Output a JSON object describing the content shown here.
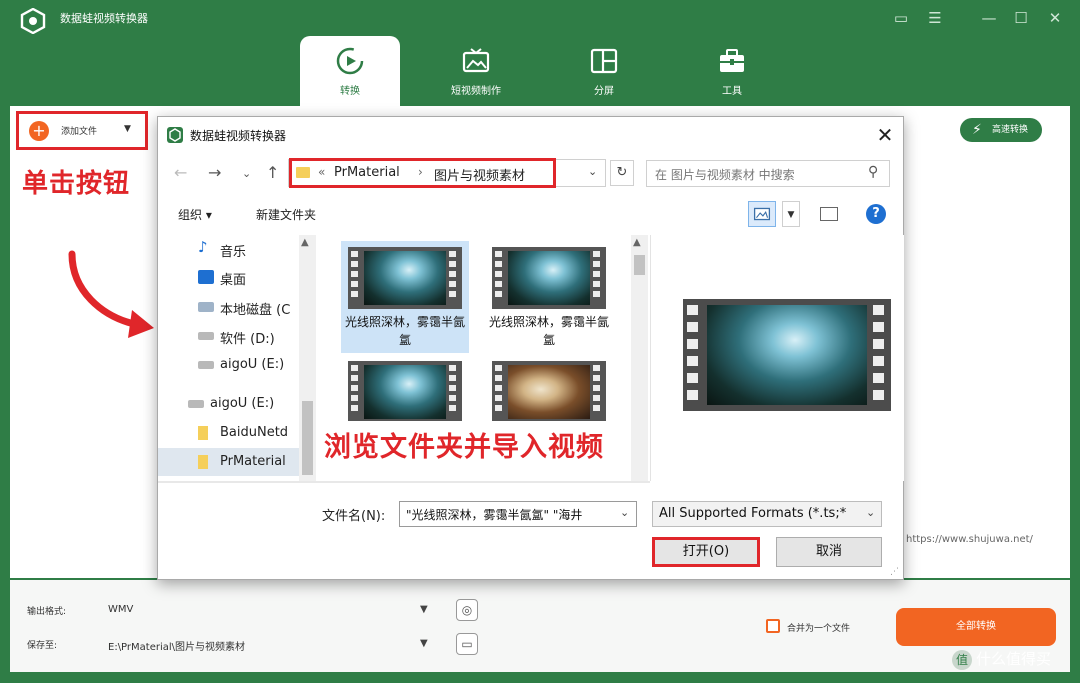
{
  "app": {
    "title": "数据蛙视频转换器",
    "tabs": [
      {
        "label": "转换",
        "icon": "convert-icon",
        "active": true
      },
      {
        "label": "短视频制作",
        "icon": "short-video-icon",
        "active": false
      },
      {
        "label": "分屏",
        "icon": "split-screen-icon",
        "active": false
      },
      {
        "label": "工具",
        "icon": "toolbox-icon",
        "active": false
      }
    ],
    "add_file_label": "添加文件",
    "speed_label": "高速转换",
    "watermark_url": "https://www.shujuwa.net/"
  },
  "annotations": {
    "click_button": "单击按钮",
    "browse_folder": "浏览文件夹并导入视频"
  },
  "bottom": {
    "output_format_label": "输出格式:",
    "output_format_value": "WMV",
    "save_to_label": "保存至:",
    "save_to_value": "E:\\PrMaterial\\图片与视频素材",
    "merge_label": "合并为一个文件",
    "convert_all_label": "全部转换",
    "site_watermark": "什么值得买"
  },
  "dialog": {
    "title": "数据蛙视频转换器",
    "address": {
      "prefix": "«",
      "crumbs": [
        "PrMaterial",
        "图片与视频素材"
      ]
    },
    "search_placeholder": "在 图片与视频素材 中搜索",
    "toolbar": {
      "organize": "组织 ▾",
      "new_folder": "新建文件夹"
    },
    "sidebar": [
      {
        "label": "音乐",
        "icon": "music-icon"
      },
      {
        "label": "桌面",
        "icon": "desktop-icon"
      },
      {
        "label": "本地磁盘 (C",
        "icon": "drive-icon"
      },
      {
        "label": "软件 (D:)",
        "icon": "drive-icon"
      },
      {
        "label": "aigoU (E:)",
        "icon": "drive-icon"
      },
      {
        "label": "aigoU (E:)",
        "icon": "drive-icon"
      },
      {
        "label": "BaiduNetd",
        "icon": "folder-icon"
      },
      {
        "label": "PrMaterial",
        "icon": "folder-icon",
        "selected": true
      }
    ],
    "files": [
      {
        "caption": "光线照深林，雾霭半氤氲",
        "thumb": "forest",
        "selected": true
      },
      {
        "caption": "光线照深林，雾霭半氤氲",
        "thumb": "forest",
        "selected": false
      },
      {
        "caption": "",
        "thumb": "forest",
        "selected": false
      },
      {
        "caption": "",
        "thumb": "bread",
        "selected": false
      }
    ],
    "file_name_label": "文件名(N):",
    "file_name_value": "\"光线照深林，雾霭半氤氲\" \"海井",
    "file_type_value": "All Supported Formats (*.ts;*",
    "open_label": "打开(O)",
    "cancel_label": "取消",
    "help_label": "?"
  }
}
